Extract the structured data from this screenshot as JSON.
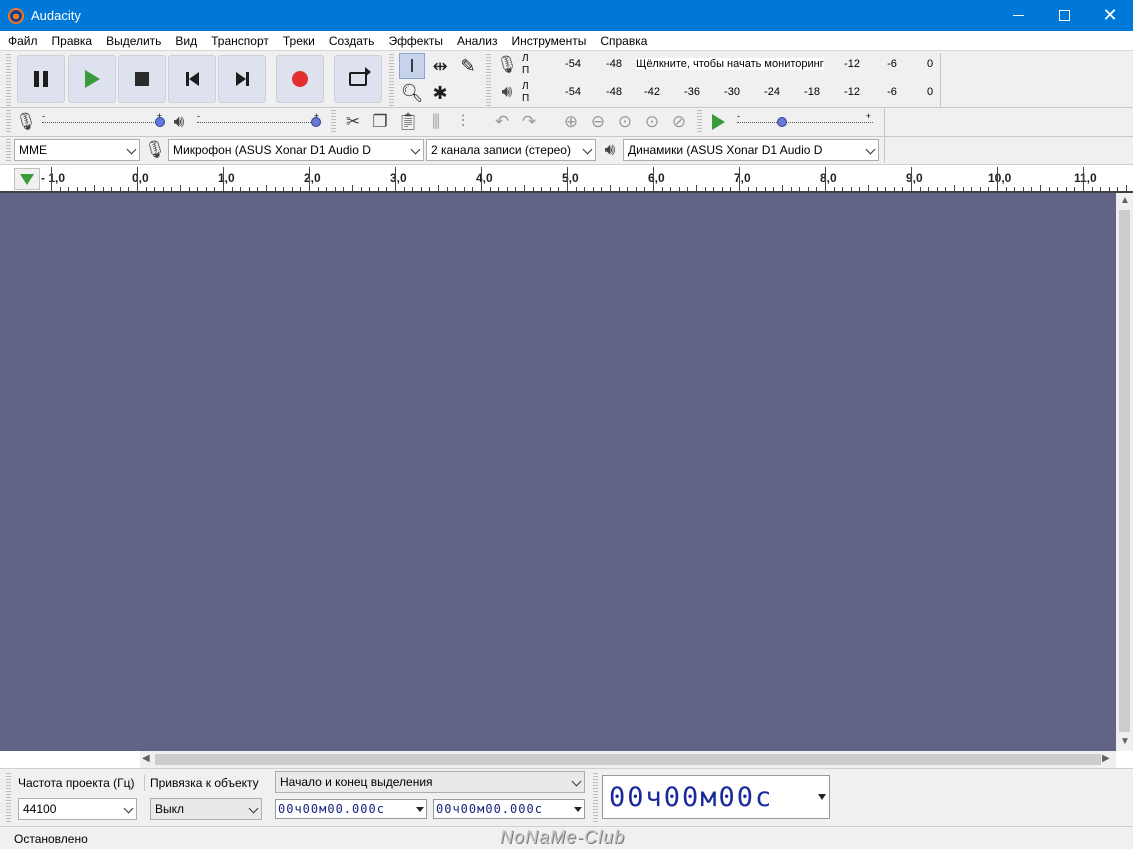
{
  "window": {
    "title": "Audacity",
    "accent": "#0078d7"
  },
  "menu": [
    "Файл",
    "Правка",
    "Выделить",
    "Вид",
    "Транспорт",
    "Треки",
    "Создать",
    "Эффекты",
    "Анализ",
    "Инструменты",
    "Справка"
  ],
  "transport": {
    "icons": [
      "pause-icon",
      "play-icon",
      "stop-icon",
      "skip-start-icon",
      "skip-end-icon",
      "record-icon",
      "loop-icon"
    ]
  },
  "meters": {
    "record_channel_top": "Л",
    "record_channel_bottom": "П",
    "play_channel_top": "Л",
    "play_channel_bottom": "П",
    "record_hint": "Щёлкните, чтобы начать мониторинг",
    "record_ticks_left": [
      "-54",
      "-48"
    ],
    "record_ticks_right": [
      "-12",
      "-6",
      "0"
    ],
    "play_ticks": [
      "-54",
      "-48",
      "-42",
      "-36",
      "-30",
      "-24",
      "-18",
      "-12",
      "-6",
      "0"
    ]
  },
  "sliders": {
    "minus": "-",
    "plus": "+"
  },
  "devices": {
    "host": "MME",
    "input": "Микрофон (ASUS Xonar D1 Audio D",
    "channels": "2 канала записи (стерео)",
    "output": "Динамики (ASUS Xonar D1 Audio D"
  },
  "ruler": {
    "labels": [
      "- 1,0",
      "0,0",
      "1,0",
      "2,0",
      "3,0",
      "4,0",
      "5,0",
      "6,0",
      "7,0",
      "8,0",
      "9,0",
      "10,0",
      "11,0"
    ]
  },
  "colors": {
    "track_bg": "#626485",
    "time_text": "#1a237e",
    "play_green": "#3a9b3a",
    "record_red": "#e23030"
  },
  "selection": {
    "rate_label": "Частота проекта (Гц)",
    "snap_label": "Привязка к объекту",
    "mode": "Начало и конец выделения",
    "rate_value": "44100",
    "snap_value": "Выкл",
    "start_time": "00ч00м00.000с",
    "end_time": "00ч00м00.000с",
    "audio_position": "00ч00м00с"
  },
  "status": {
    "text": "Остановлено",
    "watermark": "NoNaMe-Club"
  }
}
